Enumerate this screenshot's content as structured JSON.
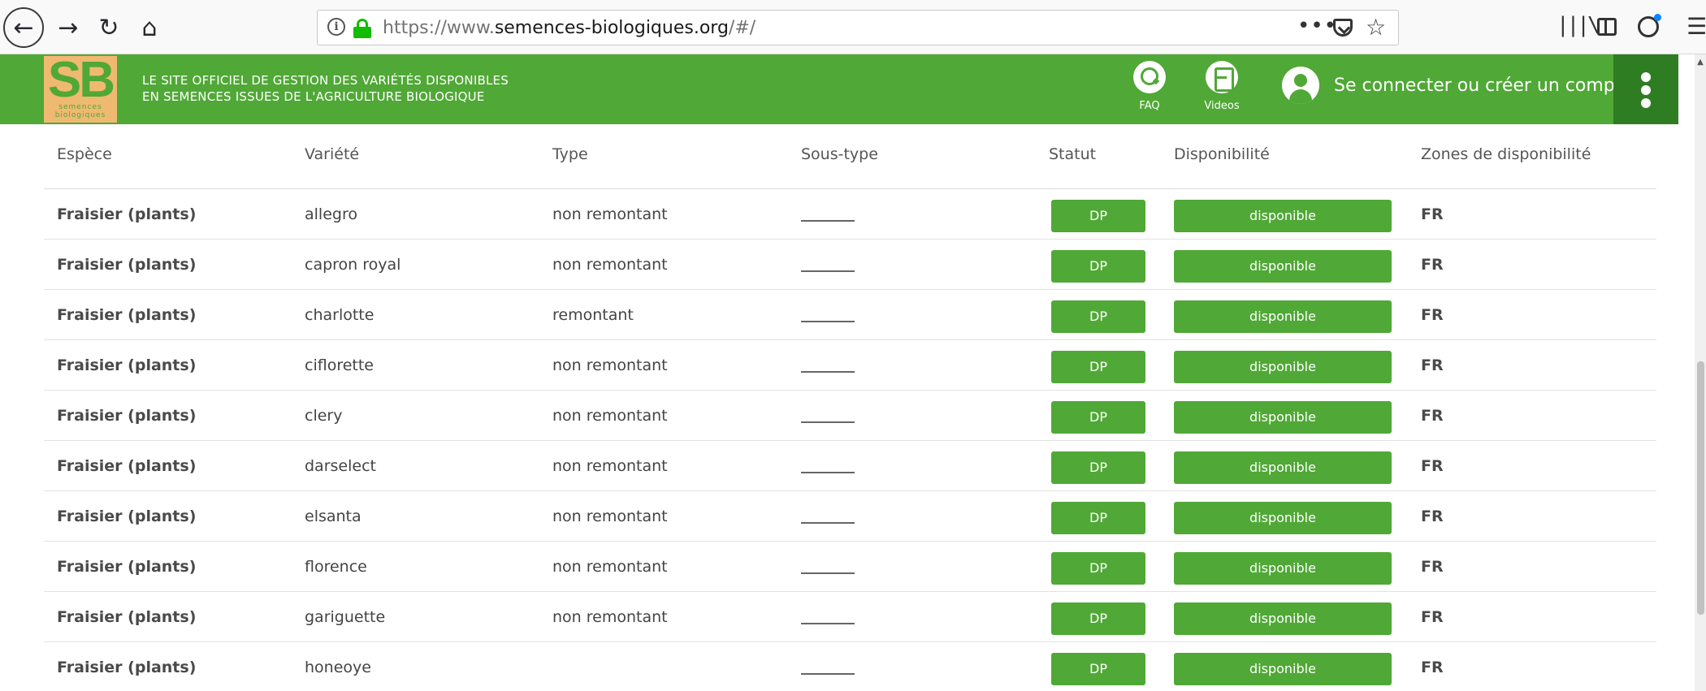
{
  "browser": {
    "url_prefix": "https://www.",
    "url_domain": "semences-biologiques.org",
    "url_suffix": "/#/",
    "more_label": "•••",
    "star_label": "☆",
    "library_label": "|||\\",
    "menu_label": "☰"
  },
  "header": {
    "logo_text": "SB",
    "logo_subtext": "semences biologiques",
    "tagline_line1": "Le site officiel de gestion des variétés disponibles",
    "tagline_line2": "en semences issues de l'agriculture biologique",
    "faq_label": "FAQ",
    "videos_label": "Videos",
    "login_label": "Se connecter ou créer un compte",
    "accent_color": "#50a836",
    "menu_color": "#2f7d22"
  },
  "table": {
    "columns": [
      "Espèce",
      "Variété",
      "Type",
      "Sous-type",
      "Statut",
      "Disponibilité",
      "Zones de disponibilité"
    ],
    "rows": [
      {
        "species": "Fraisier (plants)",
        "variety": "allegro",
        "type": "non remontant",
        "subtype": "",
        "status": "DP",
        "availability": "disponible",
        "zones": "FR"
      },
      {
        "species": "Fraisier (plants)",
        "variety": "capron royal",
        "type": "non remontant",
        "subtype": "",
        "status": "DP",
        "availability": "disponible",
        "zones": "FR"
      },
      {
        "species": "Fraisier (plants)",
        "variety": "charlotte",
        "type": "remontant",
        "subtype": "",
        "status": "DP",
        "availability": "disponible",
        "zones": "FR"
      },
      {
        "species": "Fraisier (plants)",
        "variety": "ciflorette",
        "type": "non remontant",
        "subtype": "",
        "status": "DP",
        "availability": "disponible",
        "zones": "FR"
      },
      {
        "species": "Fraisier (plants)",
        "variety": "clery",
        "type": "non remontant",
        "subtype": "",
        "status": "DP",
        "availability": "disponible",
        "zones": "FR"
      },
      {
        "species": "Fraisier (plants)",
        "variety": "darselect",
        "type": "non remontant",
        "subtype": "",
        "status": "DP",
        "availability": "disponible",
        "zones": "FR"
      },
      {
        "species": "Fraisier (plants)",
        "variety": "elsanta",
        "type": "non remontant",
        "subtype": "",
        "status": "DP",
        "availability": "disponible",
        "zones": "FR"
      },
      {
        "species": "Fraisier (plants)",
        "variety": "florence",
        "type": "non remontant",
        "subtype": "",
        "status": "DP",
        "availability": "disponible",
        "zones": "FR"
      },
      {
        "species": "Fraisier (plants)",
        "variety": "gariguette",
        "type": "non remontant",
        "subtype": "",
        "status": "DP",
        "availability": "disponible",
        "zones": "FR"
      },
      {
        "species": "Fraisier (plants)",
        "variety": "honeoye",
        "type": "",
        "subtype": "",
        "status": "DP",
        "availability": "disponible",
        "zones": "FR"
      }
    ]
  }
}
